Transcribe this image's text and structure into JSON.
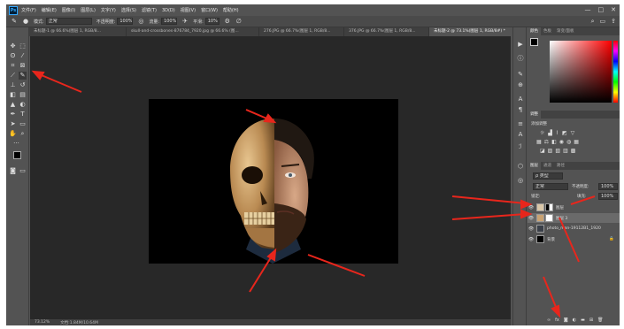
{
  "app": {
    "logo_text": "Ps"
  },
  "menu": [
    "文件(F)",
    "编辑(E)",
    "图像(I)",
    "图层(L)",
    "文字(Y)",
    "选择(S)",
    "滤镜(T)",
    "3D(D)",
    "视图(V)",
    "窗口(W)",
    "帮助(H)"
  ],
  "window_controls": [
    "—",
    "□",
    "✕"
  ],
  "options": {
    "mode_label": "模式:",
    "mode_value": "正常",
    "opacity_label": "不透明度:",
    "opacity_value": "100%",
    "flow_label": "流量:",
    "flow_value": "100%",
    "smooth_label": "平滑:",
    "smooth_value": "10%"
  },
  "tabs": [
    {
      "label": "未标题-1 @ 66.6%(图层 1, RGB/8...",
      "active": false
    },
    {
      "label": "skull-and-crossbones-876784_7920.jpg @ 66.6% (图...",
      "active": false
    },
    {
      "label": "276.JPG @ 66.7%(图层 1, RGB/8...",
      "active": false
    },
    {
      "label": "376.JPG @ 66.7%(图层 1, RGB/8...",
      "active": false
    },
    {
      "label": "未标题-2 @ 73.1%(图层 1, RGB/8#) *",
      "active": true
    }
  ],
  "color_panel": {
    "tabs": [
      "颜色",
      "色板",
      "渐变/面板"
    ],
    "base_color": "#ff0000"
  },
  "adjustments_panel": {
    "tab": "调整",
    "title": "添加调整"
  },
  "layers_panel": {
    "tabs": [
      "图层",
      "通道",
      "路径"
    ],
    "filter_label": "ρ 类型",
    "blend_mode": "正常",
    "opacity_label": "不透明度:",
    "opacity_value": "100%",
    "lock_label": "锁定:",
    "fill_label": "填充:",
    "fill_value": "100%",
    "layers": [
      {
        "name": "图层",
        "selected": false
      },
      {
        "name": "图层 3",
        "selected": true
      },
      {
        "name": "photo_man-19112B1_1920",
        "selected": false
      },
      {
        "name": "背景",
        "selected": false
      }
    ]
  },
  "status": {
    "zoom": "73.12%",
    "doc": "文档:1.84M/10.64M"
  }
}
